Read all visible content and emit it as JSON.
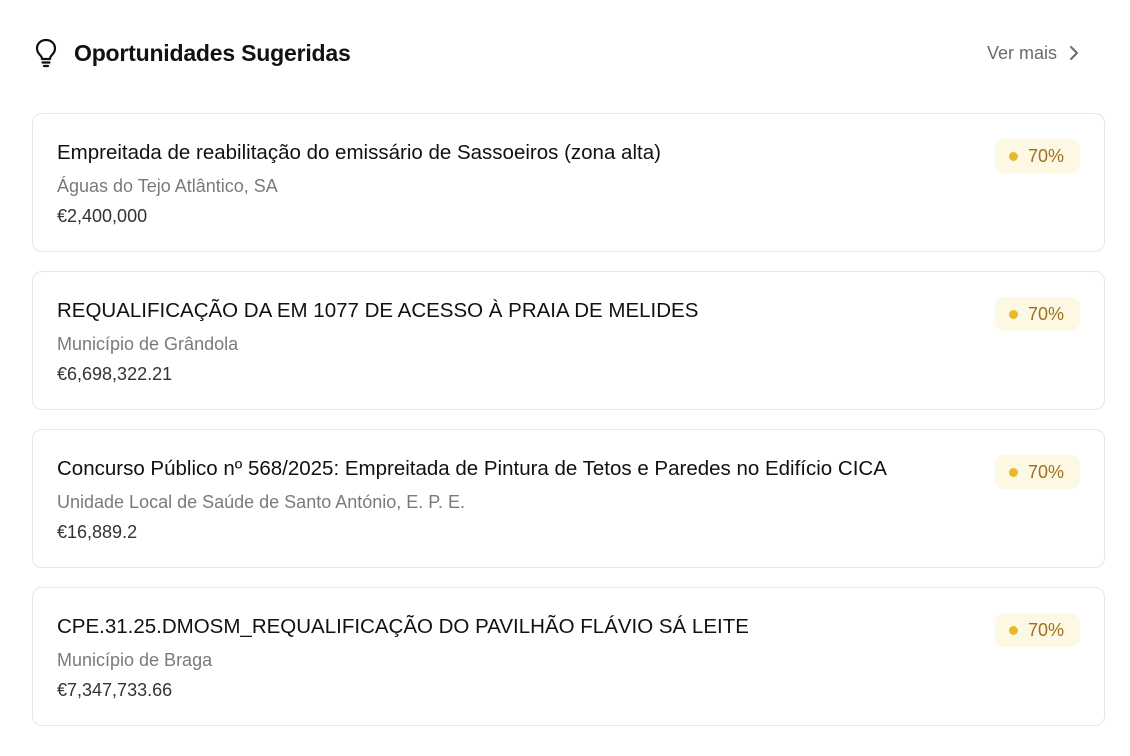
{
  "header": {
    "title": "Oportunidades Sugeridas",
    "see_more_label": "Ver mais",
    "title_icon": "lightbulb-icon",
    "see_more_icon": "chevron-right-icon"
  },
  "colors": {
    "badge_background": "#fdf8e4",
    "badge_dot": "#e7b92c",
    "badge_text": "#a0701a",
    "card_border": "#e6e6e6"
  },
  "opportunities": [
    {
      "title": "Empreitada de reabilitação do emissário de Sassoeiros (zona alta)",
      "organization": "Águas do Tejo Atlântico, SA",
      "value": "€2,400,000",
      "score": "70%"
    },
    {
      "title": "REQUALIFICAÇÃO DA EM 1077 DE ACESSO À PRAIA DE MELIDES",
      "organization": "Município de Grândola",
      "value": "€6,698,322.21",
      "score": "70%"
    },
    {
      "title": "Concurso Público nº 568/2025: Empreitada de Pintura de Tetos e Paredes no Edifício CICA",
      "organization": "Unidade Local de Saúde de Santo António, E. P. E.",
      "value": "€16,889.2",
      "score": "70%"
    },
    {
      "title": "CPE.31.25.DMOSM_REQUALIFICAÇÃO DO PAVILHÃO FLÁVIO SÁ LEITE",
      "organization": "Município de Braga",
      "value": "€7,347,733.66",
      "score": "70%"
    }
  ]
}
